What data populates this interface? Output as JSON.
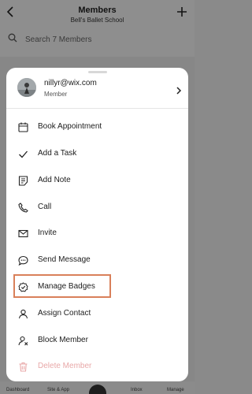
{
  "header": {
    "title": "Members",
    "subtitle": "Bell's Ballet School"
  },
  "search": {
    "placeholder": "Search 7 Members"
  },
  "tabbar": {
    "tabs": [
      "Dashboard",
      "Site & App",
      "Inbox",
      "Manage"
    ]
  },
  "profile": {
    "email": "nillyr@wix.com",
    "role": "Member"
  },
  "menu": {
    "items": [
      {
        "label": "Book Appointment",
        "icon": "calendar-icon"
      },
      {
        "label": "Add a Task",
        "icon": "checkmark-icon"
      },
      {
        "label": "Add Note",
        "icon": "note-icon"
      },
      {
        "label": "Call",
        "icon": "phone-icon"
      },
      {
        "label": "Invite",
        "icon": "envelope-icon"
      },
      {
        "label": "Send Message",
        "icon": "chat-bubble-icon"
      },
      {
        "label": "Manage Badges",
        "icon": "badge-check-icon"
      },
      {
        "label": "Assign Contact",
        "icon": "user-icon"
      },
      {
        "label": "Block Member",
        "icon": "block-user-icon"
      },
      {
        "label": "Delete Member",
        "icon": "trash-icon"
      }
    ]
  },
  "colors": {
    "highlight": "#d9805a",
    "danger": "#e8a8a8",
    "overlay": "rgba(0,0,0,0.42)"
  }
}
